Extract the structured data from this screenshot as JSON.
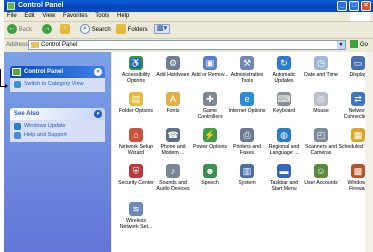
{
  "window": {
    "title": "Control Panel"
  },
  "menu": [
    "File",
    "Edit",
    "View",
    "Favorites",
    "Tools",
    "Help"
  ],
  "toolbar": {
    "back": "Back",
    "search": "Search",
    "folders": "Folders"
  },
  "address": {
    "label": "Address",
    "value": "Control Panel",
    "go": "Go"
  },
  "left": {
    "panel1": {
      "title": "Control Panel",
      "item": "Switch to Category View"
    },
    "panel2": {
      "title": "See Also",
      "items": [
        "Windows Update",
        "Help and Support"
      ]
    }
  },
  "items": [
    {
      "label": "Accessibility Options",
      "icon": "accessibility-icon",
      "color": "#2f9a3a",
      "glyph": "♿"
    },
    {
      "label": "Add Hardware",
      "icon": "hardware-icon",
      "color": "#6f7f91",
      "glyph": "⚙"
    },
    {
      "label": "Add or Remov...",
      "icon": "add-remove-icon",
      "color": "#5b7fcf",
      "glyph": "▣"
    },
    {
      "label": "Administrative Tools",
      "icon": "admin-tools-icon",
      "color": "#6d88b8",
      "glyph": "⚒"
    },
    {
      "label": "Automatic Updates",
      "icon": "updates-icon",
      "color": "#2c7bd1",
      "glyph": "↻"
    },
    {
      "label": "Date and Time",
      "icon": "clock-icon",
      "color": "#9fb8d8",
      "glyph": "◷"
    },
    {
      "label": "Display",
      "icon": "display-icon",
      "color": "#4a6fb0",
      "glyph": "▭"
    },
    {
      "label": "Folder Options",
      "icon": "folder-icon",
      "color": "#e5b93a",
      "glyph": "▤"
    },
    {
      "label": "Fonts",
      "icon": "fonts-icon",
      "color": "#e0b048",
      "glyph": "A"
    },
    {
      "label": "Game Controllers",
      "icon": "gamepad-icon",
      "color": "#7e8792",
      "glyph": "✚"
    },
    {
      "label": "Internet Options",
      "icon": "internet-icon",
      "color": "#2a8bd6",
      "glyph": "e"
    },
    {
      "label": "Keyboard",
      "icon": "keyboard-icon",
      "color": "#8a8f99",
      "glyph": "⌨"
    },
    {
      "label": "Mouse",
      "icon": "mouse-icon",
      "color": "#b9bec8",
      "glyph": "◎"
    },
    {
      "label": "Network Connections",
      "icon": "network-icon",
      "color": "#3d76c2",
      "glyph": "⇄"
    },
    {
      "label": "Network Setup Wizard",
      "icon": "network-wizard-icon",
      "color": "#c9523a",
      "glyph": "⌂"
    },
    {
      "label": "Phone and Modem ...",
      "icon": "phone-icon",
      "color": "#5f6f84",
      "glyph": "☎"
    },
    {
      "label": "Power Options",
      "icon": "power-icon",
      "color": "#3e9e44",
      "glyph": "⚡"
    },
    {
      "label": "Printers and Faxes",
      "icon": "printer-icon",
      "color": "#6b7a8e",
      "glyph": "⎙"
    },
    {
      "label": "Regional and Language ...",
      "icon": "globe-icon",
      "color": "#2a7cc4",
      "glyph": "◍"
    },
    {
      "label": "Scanners and Cameras",
      "icon": "scanner-icon",
      "color": "#7b8a9c",
      "glyph": "◰"
    },
    {
      "label": "Scheduled Tasks",
      "icon": "tasks-icon",
      "color": "#d9a72c",
      "glyph": "▦"
    },
    {
      "label": "Security Center",
      "icon": "shield-icon",
      "color": "#b83a3a",
      "glyph": "⛨"
    },
    {
      "label": "Sounds and Audio Devices",
      "icon": "speaker-icon",
      "color": "#7a8697",
      "glyph": "♪"
    },
    {
      "label": "Speech",
      "icon": "speech-icon",
      "color": "#3c8f4c",
      "glyph": "☻"
    },
    {
      "label": "System",
      "icon": "system-icon",
      "color": "#4b6ea8",
      "glyph": "▥"
    },
    {
      "label": "Taskbar and Start Menu",
      "icon": "taskbar-icon",
      "color": "#3566b8",
      "glyph": "▬"
    },
    {
      "label": "User Accounts",
      "icon": "users-icon",
      "color": "#5a8a3c",
      "glyph": "☺"
    },
    {
      "label": "Windows Firewall",
      "icon": "firewall-icon",
      "color": "#b8562a",
      "glyph": "▩"
    },
    {
      "label": "Wireless Network Set...",
      "icon": "wireless-icon",
      "color": "#6b88b8",
      "glyph": "≋"
    }
  ]
}
